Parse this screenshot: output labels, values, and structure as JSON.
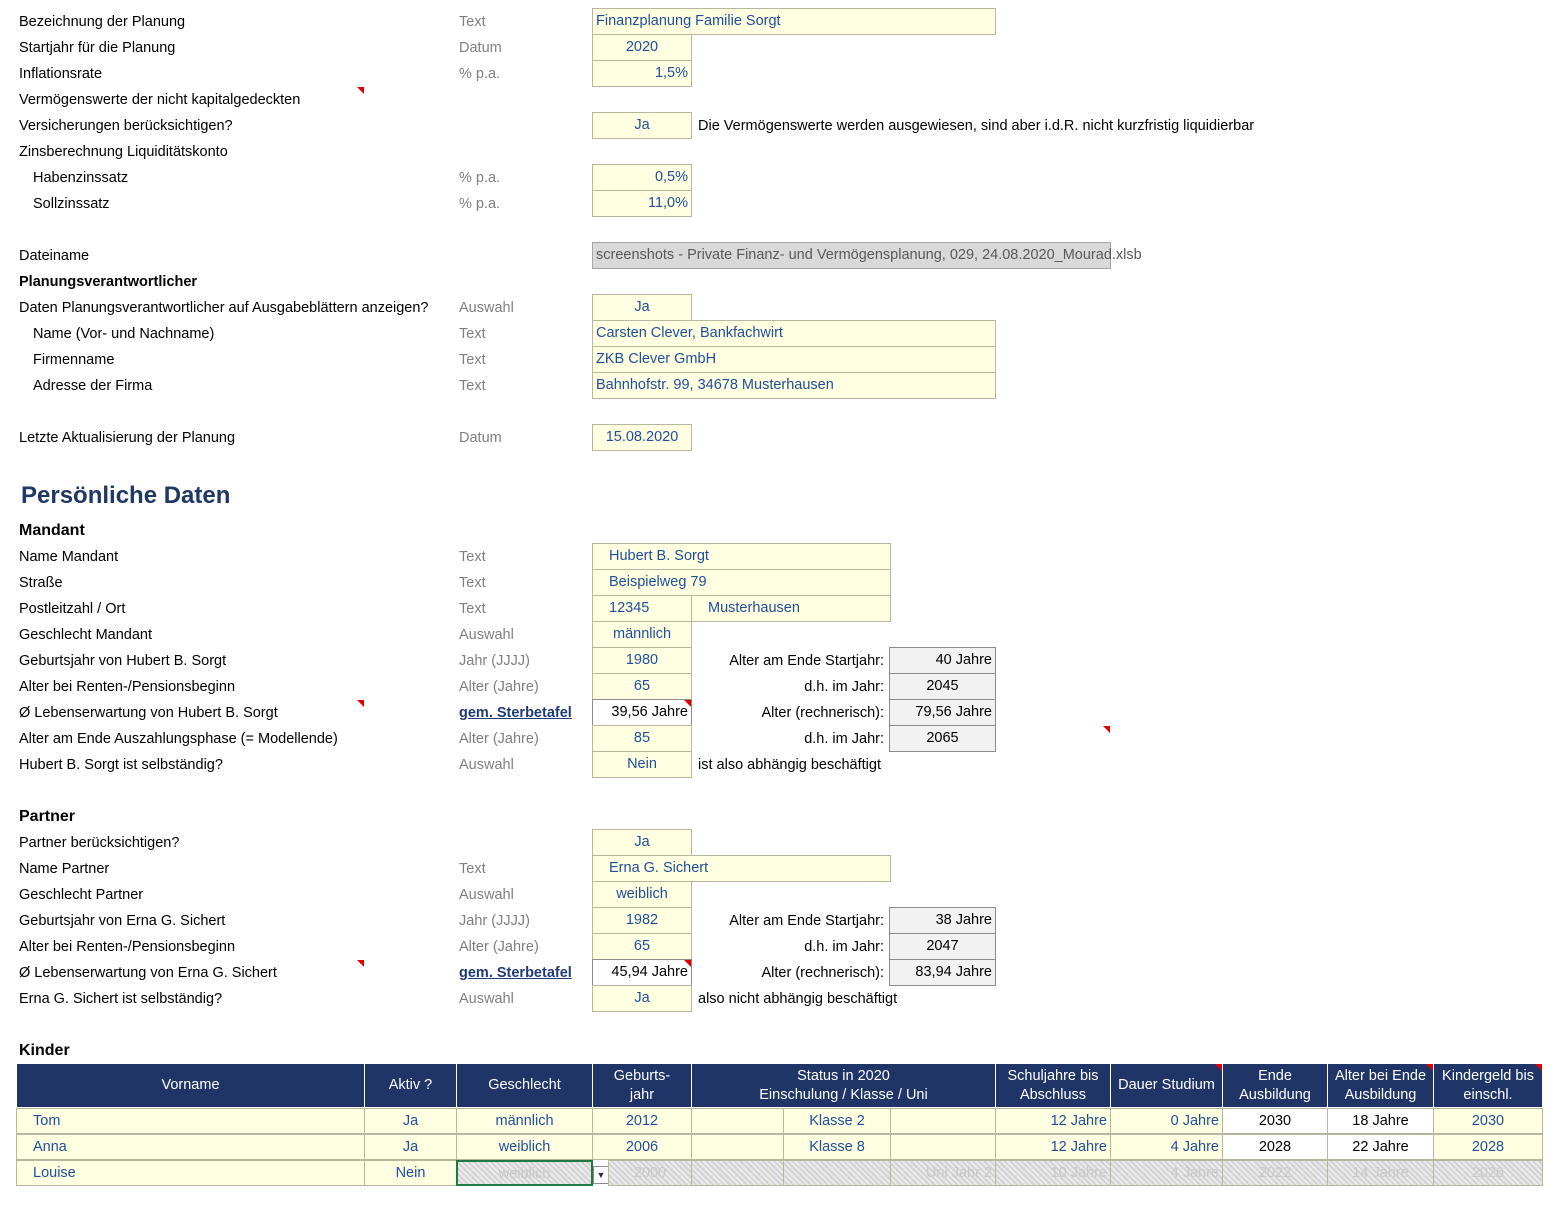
{
  "general": {
    "bezeichnung": {
      "label": "Bezeichnung der Planung",
      "unit": "Text",
      "value": "Finanzplanung Familie Sorgt"
    },
    "startjahr": {
      "label": "Startjahr für die Planung",
      "unit": "Datum",
      "value": "2020"
    },
    "inflation": {
      "label": "Inflationsrate",
      "unit": "% p.a.",
      "value": "1,5%"
    },
    "vermoegen_label1": "Vermögenswerte der nicht kapitalgedeckten",
    "vermoegen_label2": "Versicherungen berücksichtigen?",
    "vermoegen_value": "Ja",
    "vermoegen_note": "Die Vermögenswerte werden ausgewiesen, sind aber i.d.R. nicht kurzfristig liquidierbar",
    "zins_label": "Zinsberechnung Liquiditätskonto",
    "haben": {
      "label": "Habenzinssatz",
      "unit": "% p.a.",
      "value": "0,5%"
    },
    "soll": {
      "label": "Sollzinssatz",
      "unit": "% p.a.",
      "value": "11,0%"
    },
    "dateiname_label": "Dateiname",
    "dateiname_value": "screenshots - Private Finanz- und Vermögensplanung, 029, 24.08.2020_Mourad.xlsb"
  },
  "planer": {
    "title": "Planungsverantwortlicher",
    "anzeigen": {
      "label": "Daten Planungsverantwortlicher auf Ausgabeblättern anzeigen?",
      "unit": "Auswahl",
      "value": "Ja"
    },
    "name": {
      "label": "Name (Vor- und Nachname)",
      "unit": "Text",
      "value": "Carsten Clever, Bankfachwirt"
    },
    "firma": {
      "label": "Firmenname",
      "unit": "Text",
      "value": "ZKB Clever GmbH"
    },
    "adresse": {
      "label": "Adresse der Firma",
      "unit": "Text",
      "value": "Bahnhofstr. 99, 34678 Musterhausen"
    },
    "aktualisierung": {
      "label": "Letzte Aktualisierung der Planung",
      "unit": "Datum",
      "value": "15.08.2020"
    }
  },
  "persoenlich_title": "Persönliche Daten",
  "mandant": {
    "title": "Mandant",
    "name": {
      "label": "Name Mandant",
      "unit": "Text",
      "value": "Hubert B. Sorgt"
    },
    "strasse": {
      "label": "Straße",
      "unit": "Text",
      "value": "Beispielweg 79"
    },
    "plz": {
      "label": "Postleitzahl / Ort",
      "unit": "Text",
      "plz": "12345",
      "ort": "Musterhausen"
    },
    "geschlecht": {
      "label": "Geschlecht Mandant",
      "unit": "Auswahl",
      "value": "männlich"
    },
    "geburtsjahr": {
      "label": "Geburtsjahr von Hubert B. Sorgt",
      "unit": "Jahr (JJJJ)",
      "value": "1980",
      "side_label": "Alter am Ende Startjahr:",
      "side_value": "40 Jahre"
    },
    "rente": {
      "label": "Alter bei Renten-/Pensionsbeginn",
      "unit": "Alter (Jahre)",
      "value": "65",
      "side_label": "d.h. im Jahr:",
      "side_value": "2045"
    },
    "leben": {
      "label": "Ø Lebenserwartung von Hubert B. Sorgt",
      "unit": "gem. Sterbetafel",
      "value": "39,56 Jahre",
      "side_label": "Alter (rechnerisch):",
      "side_value": "79,56 Jahre"
    },
    "ende": {
      "label": "Alter am Ende Auszahlungsphase (= Modellende)",
      "unit": "Alter (Jahre)",
      "value": "85",
      "side_label": "d.h. im Jahr:",
      "side_value": "2065"
    },
    "selbst": {
      "label": "Hubert B. Sorgt ist selbständig?",
      "unit": "Auswahl",
      "value": "Nein",
      "note": "ist also abhängig beschäftigt"
    }
  },
  "partner": {
    "title": "Partner",
    "beruecksichtigen": {
      "label": "Partner berücksichtigen?",
      "value": "Ja"
    },
    "name": {
      "label": "Name Partner",
      "unit": "Text",
      "value": "Erna G. Sichert"
    },
    "geschlecht": {
      "label": "Geschlecht Partner",
      "unit": "Auswahl",
      "value": "weiblich"
    },
    "geburtsjahr": {
      "label": "Geburtsjahr von Erna G. Sichert",
      "unit": "Jahr (JJJJ)",
      "value": "1982",
      "side_label": "Alter am Ende Startjahr:",
      "side_value": "38 Jahre"
    },
    "rente": {
      "label": "Alter bei Renten-/Pensionsbeginn",
      "unit": "Alter (Jahre)",
      "value": "65",
      "side_label": "d.h. im Jahr:",
      "side_value": "2047"
    },
    "leben": {
      "label": "Ø Lebenserwartung von Erna G. Sichert",
      "unit": "gem. Sterbetafel",
      "value": "45,94 Jahre",
      "side_label": "Alter (rechnerisch):",
      "side_value": "83,94 Jahre"
    },
    "selbst": {
      "label": "Erna G. Sichert ist selbständig?",
      "unit": "Auswahl",
      "value": "Ja",
      "note": "also nicht abhängig beschäftigt"
    }
  },
  "kinder": {
    "title": "Kinder",
    "headers": {
      "vorname": "Vorname",
      "aktiv": "Aktiv ?",
      "geschlecht": "Geschlecht",
      "geburtsjahr": "Geburts-\njahr",
      "status": "Status in 2020\nEinschulung / Klasse / Uni",
      "schuljahre": "Schuljahre bis\nAbschluss",
      "studium": "Dauer Studium",
      "ende": "Ende\nAusbildung",
      "alter": "Alter bei Ende\nAusbildung",
      "kindergeld": "Kindergeld bis\neinschl."
    },
    "rows": [
      {
        "vorname": "Tom",
        "aktiv": "Ja",
        "geschlecht": "männlich",
        "geburtsjahr": "2012",
        "s1": "",
        "s2": "Klasse 2",
        "s3": "",
        "schuljahre": "12 Jahre",
        "studium": "0 Jahre",
        "ende": "2030",
        "alter": "18 Jahre",
        "kindergeld": "2030"
      },
      {
        "vorname": "Anna",
        "aktiv": "Ja",
        "geschlecht": "weiblich",
        "geburtsjahr": "2006",
        "s1": "",
        "s2": "Klasse 8",
        "s3": "",
        "schuljahre": "12 Jahre",
        "studium": "4 Jahre",
        "ende": "2028",
        "alter": "22 Jahre",
        "kindergeld": "2028"
      },
      {
        "vorname": "Louise",
        "aktiv": "Nein",
        "geschlecht": "weiblich",
        "geburtsjahr": "2000",
        "s1": "",
        "s2": "",
        "s3": "Uni Jahr 2",
        "schuljahre": "10 Jahre",
        "studium": "4 Jahre",
        "ende": "2022",
        "alter": "14 Jahre",
        "kindergeld": "2026"
      }
    ]
  }
}
